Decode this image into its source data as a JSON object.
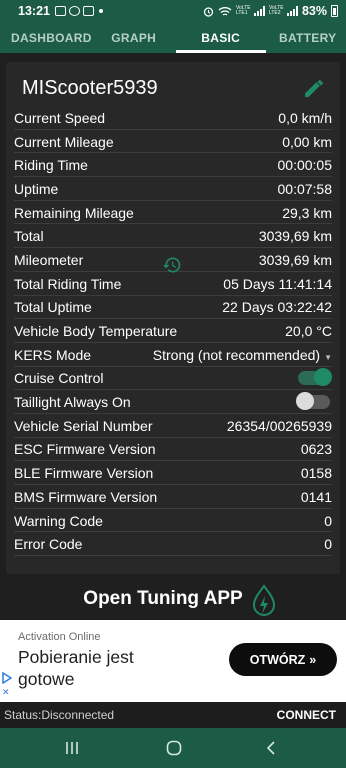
{
  "status_bar": {
    "time": "13:21",
    "network_label_1": "VoLTE LTE1",
    "network_label_2": "VoLTE LTE2",
    "battery": "83%"
  },
  "tabs": [
    {
      "label": "DASHBOARD",
      "active": false
    },
    {
      "label": "GRAPH",
      "active": false
    },
    {
      "label": "BASIC",
      "active": true
    },
    {
      "label": "BATTERY",
      "active": false
    }
  ],
  "device_name": "MIScooter5939",
  "rows": [
    {
      "label": "Current Speed",
      "value": "0,0 km/h"
    },
    {
      "label": "Current Mileage",
      "value": "0,00 km"
    },
    {
      "label": "Riding Time",
      "value": "00:00:05"
    },
    {
      "label": "Uptime",
      "value": "00:07:58"
    },
    {
      "label": "Remaining Mileage",
      "value": "29,3 km"
    },
    {
      "label": "Total",
      "value": "3039,69 km"
    },
    {
      "label": "Mileometer",
      "value": "3039,69 km"
    },
    {
      "label": "Total Riding Time",
      "value": "05 Days 11:41:14"
    },
    {
      "label": "Total Uptime",
      "value": "22 Days 03:22:42"
    },
    {
      "label": "Vehicle Body Temperature",
      "value": "20,0 °C"
    },
    {
      "label": "KERS Mode",
      "value": "Strong (not recommended)"
    },
    {
      "label": "Cruise Control",
      "toggle": true
    },
    {
      "label": "Taillight Always On",
      "toggle": false
    },
    {
      "label": "Vehicle Serial Number",
      "value": "26354/00265939"
    },
    {
      "label": "ESC Firmware Version",
      "value": "0623"
    },
    {
      "label": "BLE Firmware Version",
      "value": "0158"
    },
    {
      "label": "BMS Firmware Version",
      "value": "0141"
    },
    {
      "label": "Warning Code",
      "value": "0"
    },
    {
      "label": "Error Code",
      "value": "0"
    }
  ],
  "open_tuning_label": "Open Tuning APP",
  "ad": {
    "advertiser": "Activation Online",
    "title": "Pobieranie jest gotowe",
    "button_label": "OTWÓRZ"
  },
  "footer": {
    "status": "Status:Disconnected",
    "connect_label": "CONNECT"
  },
  "colors": {
    "accent": "#1c5b45",
    "toggle_on": "#1e8a68",
    "background": "#1f1f1f",
    "card": "#282828"
  },
  "icons": [
    "edit-pencil-icon",
    "reset-history-icon",
    "tuning-bolt-icon",
    "recents-icon",
    "home-icon",
    "back-icon"
  ]
}
